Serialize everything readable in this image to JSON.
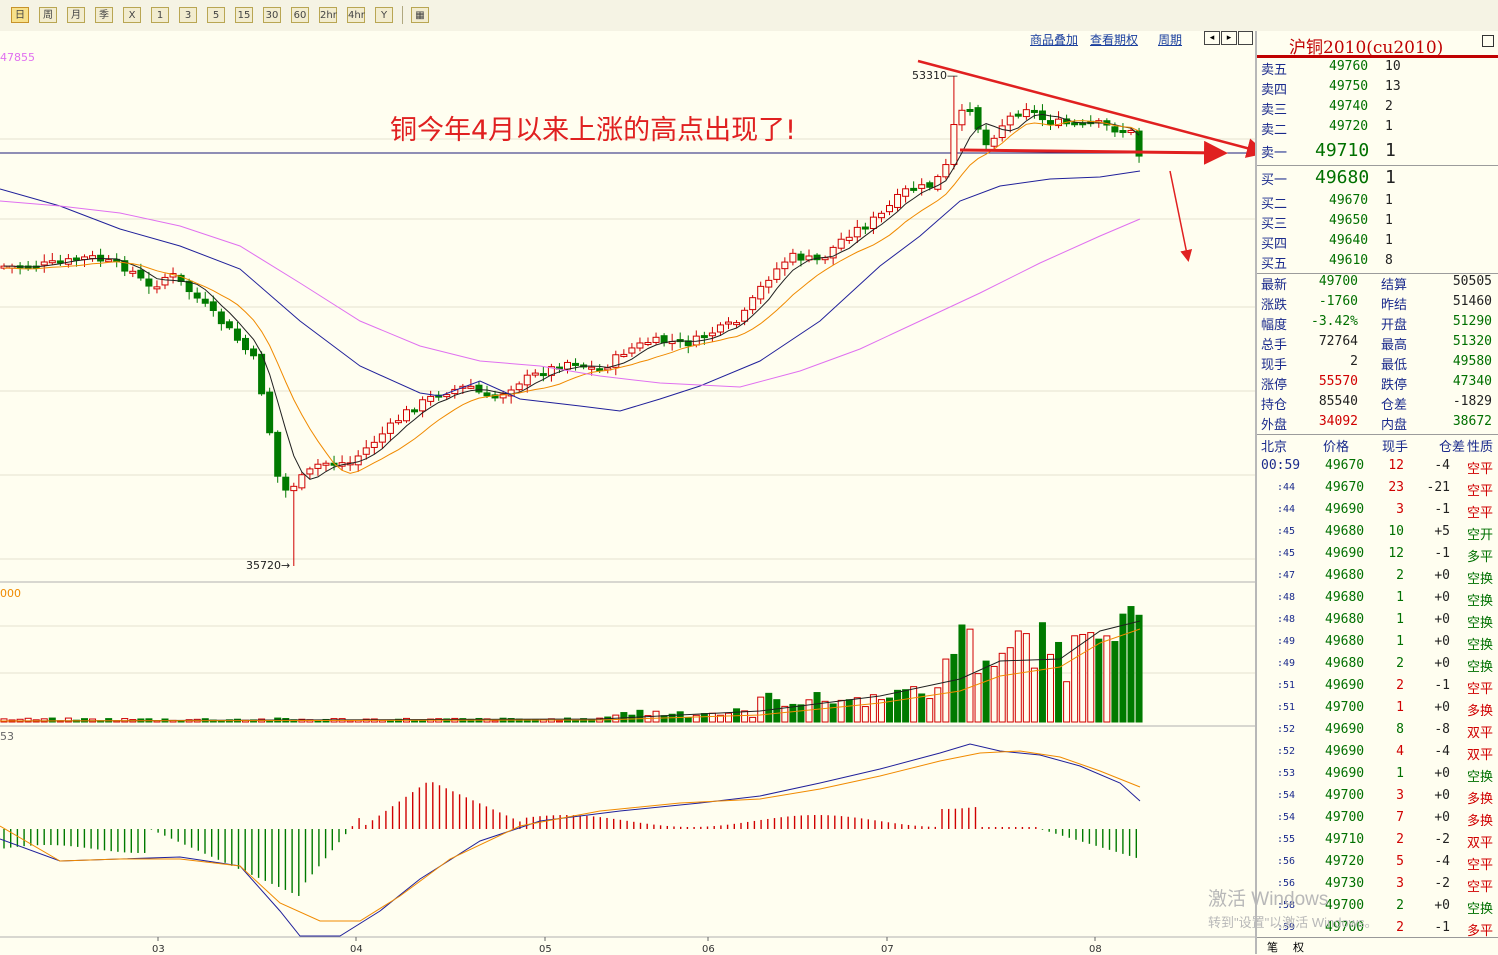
{
  "toolbar": {
    "periods": [
      "日",
      "周",
      "月",
      "季",
      "X",
      "1",
      "3",
      "5",
      "15",
      "30",
      "60",
      "2hr",
      "4hr",
      "Y",
      "▦"
    ],
    "active": "日"
  },
  "chart_links": [
    "商品叠加",
    "查看期权",
    "周期"
  ],
  "annotation": "铜今年4月以来上涨的高点出现了!",
  "price_labels": {
    "high": "53310",
    "low": "35720",
    "axis_top": "47855"
  },
  "volume_axis_label": "000",
  "macd_axis_label": "53",
  "x_axis_months": [
    "03",
    "04",
    "05",
    "06",
    "07",
    "08"
  ],
  "colors": {
    "up": "#d00000",
    "down": "#007a00",
    "ma5": "#202020",
    "ma10": "#f08a00",
    "ma20": "#20209a",
    "ma60": "#e070f0",
    "arrow": "#e02020"
  },
  "panel": {
    "title": "沪铜2010(cu2010)",
    "asks": [
      {
        "label": "卖五",
        "price": "49760",
        "vol": "10"
      },
      {
        "label": "卖四",
        "price": "49750",
        "vol": "13"
      },
      {
        "label": "卖三",
        "price": "49740",
        "vol": "2"
      },
      {
        "label": "卖二",
        "price": "49720",
        "vol": "1"
      },
      {
        "label": "卖一",
        "price": "49710",
        "vol": "1"
      }
    ],
    "bids": [
      {
        "label": "买一",
        "price": "49680",
        "vol": "1"
      },
      {
        "label": "买二",
        "price": "49670",
        "vol": "1"
      },
      {
        "label": "买三",
        "price": "49650",
        "vol": "1"
      },
      {
        "label": "买四",
        "price": "49640",
        "vol": "1"
      },
      {
        "label": "买五",
        "price": "49610",
        "vol": "8"
      }
    ],
    "stats": [
      {
        "l1": "最新",
        "v1": "49700",
        "c1": "green",
        "l2": "结算",
        "v2": "50505",
        "c2": "dark"
      },
      {
        "l1": "涨跌",
        "v1": "-1760",
        "c1": "green",
        "l2": "昨结",
        "v2": "51460",
        "c2": "dark"
      },
      {
        "l1": "幅度",
        "v1": "-3.42%",
        "c1": "green",
        "l2": "开盘",
        "v2": "51290",
        "c2": "green"
      },
      {
        "l1": "总手",
        "v1": "72764",
        "c1": "dark",
        "l2": "最高",
        "v2": "51320",
        "c2": "green"
      },
      {
        "l1": "现手",
        "v1": "2",
        "c1": "dark",
        "l2": "最低",
        "v2": "49580",
        "c2": "green"
      },
      {
        "l1": "涨停",
        "v1": "55570",
        "c1": "red",
        "l2": "跌停",
        "v2": "47340",
        "c2": "green"
      },
      {
        "l1": "持仓",
        "v1": "85540",
        "c1": "dark",
        "l2": "仓差",
        "v2": "-1829",
        "c2": "dark"
      },
      {
        "l1": "外盘",
        "v1": "34092",
        "c1": "red",
        "l2": "内盘",
        "v2": "38672",
        "c2": "green"
      }
    ],
    "ticks_header": [
      "北京",
      "价格",
      "现手",
      "仓差",
      "性质"
    ],
    "ticks": [
      {
        "t": "00:59",
        "p": "49670",
        "v": "12",
        "vc": "red",
        "d": "-4",
        "k": "空平",
        "kc": "red"
      },
      {
        "t": ":44",
        "p": "49670",
        "v": "23",
        "vc": "red",
        "d": "-21",
        "k": "空平",
        "kc": "red"
      },
      {
        "t": ":44",
        "p": "49690",
        "v": "3",
        "vc": "red",
        "d": "-1",
        "k": "空平",
        "kc": "red"
      },
      {
        "t": ":45",
        "p": "49680",
        "v": "10",
        "vc": "green",
        "d": "+5",
        "k": "空开",
        "kc": "green"
      },
      {
        "t": ":45",
        "p": "49690",
        "v": "12",
        "vc": "green",
        "d": "-1",
        "k": "多平",
        "kc": "green"
      },
      {
        "t": ":47",
        "p": "49680",
        "v": "2",
        "vc": "green",
        "d": "+0",
        "k": "空换",
        "kc": "green"
      },
      {
        "t": ":48",
        "p": "49680",
        "v": "1",
        "vc": "green",
        "d": "+0",
        "k": "空换",
        "kc": "green"
      },
      {
        "t": ":48",
        "p": "49680",
        "v": "1",
        "vc": "green",
        "d": "+0",
        "k": "空换",
        "kc": "green"
      },
      {
        "t": ":49",
        "p": "49680",
        "v": "1",
        "vc": "green",
        "d": "+0",
        "k": "空换",
        "kc": "green"
      },
      {
        "t": ":49",
        "p": "49680",
        "v": "2",
        "vc": "green",
        "d": "+0",
        "k": "空换",
        "kc": "green"
      },
      {
        "t": ":51",
        "p": "49690",
        "v": "2",
        "vc": "red",
        "d": "-1",
        "k": "空平",
        "kc": "red"
      },
      {
        "t": ":51",
        "p": "49700",
        "v": "1",
        "vc": "red",
        "d": "+0",
        "k": "多换",
        "kc": "red"
      },
      {
        "t": ":52",
        "p": "49690",
        "v": "8",
        "vc": "green",
        "d": "-8",
        "k": "双平",
        "kc": "red"
      },
      {
        "t": ":52",
        "p": "49690",
        "v": "4",
        "vc": "red",
        "d": "-4",
        "k": "双平",
        "kc": "red"
      },
      {
        "t": ":53",
        "p": "49690",
        "v": "1",
        "vc": "green",
        "d": "+0",
        "k": "空换",
        "kc": "green"
      },
      {
        "t": ":54",
        "p": "49700",
        "v": "3",
        "vc": "red",
        "d": "+0",
        "k": "多换",
        "kc": "red"
      },
      {
        "t": ":54",
        "p": "49700",
        "v": "7",
        "vc": "red",
        "d": "+0",
        "k": "多换",
        "kc": "red"
      },
      {
        "t": ":55",
        "p": "49710",
        "v": "2",
        "vc": "red",
        "d": "-2",
        "k": "双平",
        "kc": "red"
      },
      {
        "t": ":56",
        "p": "49720",
        "v": "5",
        "vc": "red",
        "d": "-4",
        "k": "空平",
        "kc": "red"
      },
      {
        "t": ":56",
        "p": "49730",
        "v": "3",
        "vc": "red",
        "d": "-2",
        "k": "空平",
        "kc": "red"
      },
      {
        "t": ":58",
        "p": "49700",
        "v": "2",
        "vc": "green",
        "d": "+0",
        "k": "空换",
        "kc": "green"
      },
      {
        "t": ":59",
        "p": "49700",
        "v": "2",
        "vc": "red",
        "d": "-1",
        "k": "多平",
        "kc": "red"
      }
    ],
    "tabs": [
      "笔",
      "权"
    ]
  },
  "watermark": {
    "line1": "激活 Windows",
    "line2": "转到\"设置\"以激活 Windows。"
  }
}
